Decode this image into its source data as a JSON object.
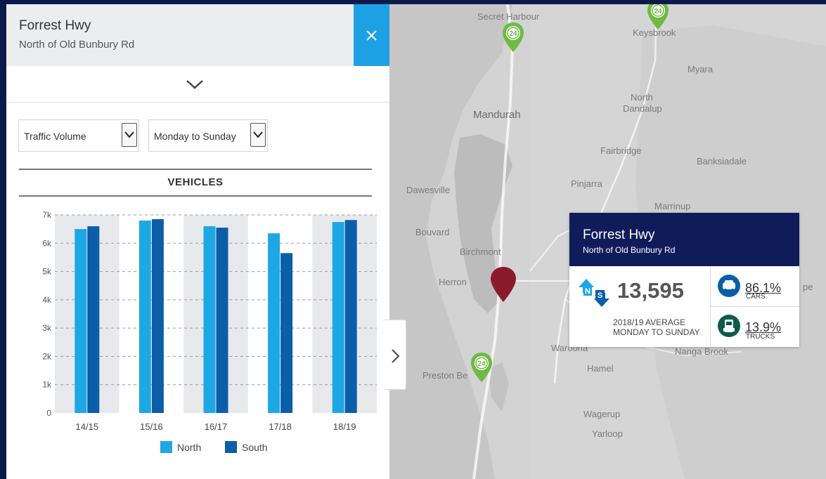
{
  "panel": {
    "title": "Forrest Hwy",
    "subtitle": "North of Old Bunbury Rd",
    "metric_select": "Traffic Volume",
    "days_select": "Monday to Sunday",
    "section_title": "VEHICLES"
  },
  "chart_data": {
    "type": "bar",
    "categories": [
      "14/15",
      "15/16",
      "16/17",
      "17/18",
      "18/19"
    ],
    "series": [
      {
        "name": "North",
        "color": "#1ea7e5",
        "values": [
          6500,
          6800,
          6600,
          6350,
          6750
        ]
      },
      {
        "name": "South",
        "color": "#0b5ea8",
        "values": [
          6600,
          6850,
          6550,
          5650,
          6820
        ]
      }
    ],
    "yticks": [
      "0",
      "1k",
      "2k",
      "3k",
      "4k",
      "5k",
      "6k",
      "7k"
    ],
    "ylim": [
      0,
      7000
    ],
    "grid": true,
    "legend": "bottom"
  },
  "map": {
    "places": [
      "Secret Harbour",
      "Keysbrook",
      "Myara",
      "North Dandalup",
      "Mandurah",
      "Fairbridge",
      "Banksiadale",
      "Dawesville",
      "Pinjarra",
      "Marrinup",
      "Bouvard",
      "Birchmont",
      "Herron",
      "Waroona",
      "Nanga Brook",
      "Hamel",
      "Preston Be",
      "Wagerup",
      "Yarloop",
      "pe"
    ],
    "north_dandalup_line1": "North",
    "north_dandalup_line2": "Dandalup",
    "pin_label": "24"
  },
  "card": {
    "title": "Forrest Hwy",
    "subtitle": "North of Old Bunbury Rd",
    "count": "13,595",
    "avg_line1": "2018/19 AVERAGE",
    "avg_line2": "MONDAY TO SUNDAY",
    "cars_pct": "86.1%",
    "cars_label": "CARS",
    "trucks_pct": "13.9%",
    "trucks_label": "TRUCKS",
    "direction_n": "N",
    "direction_s": "S"
  },
  "colors": {
    "accent": "#1da1e4",
    "header_navy": "#101c5a",
    "marker": "#8b1a2b",
    "pin_green": "#6fba44"
  }
}
